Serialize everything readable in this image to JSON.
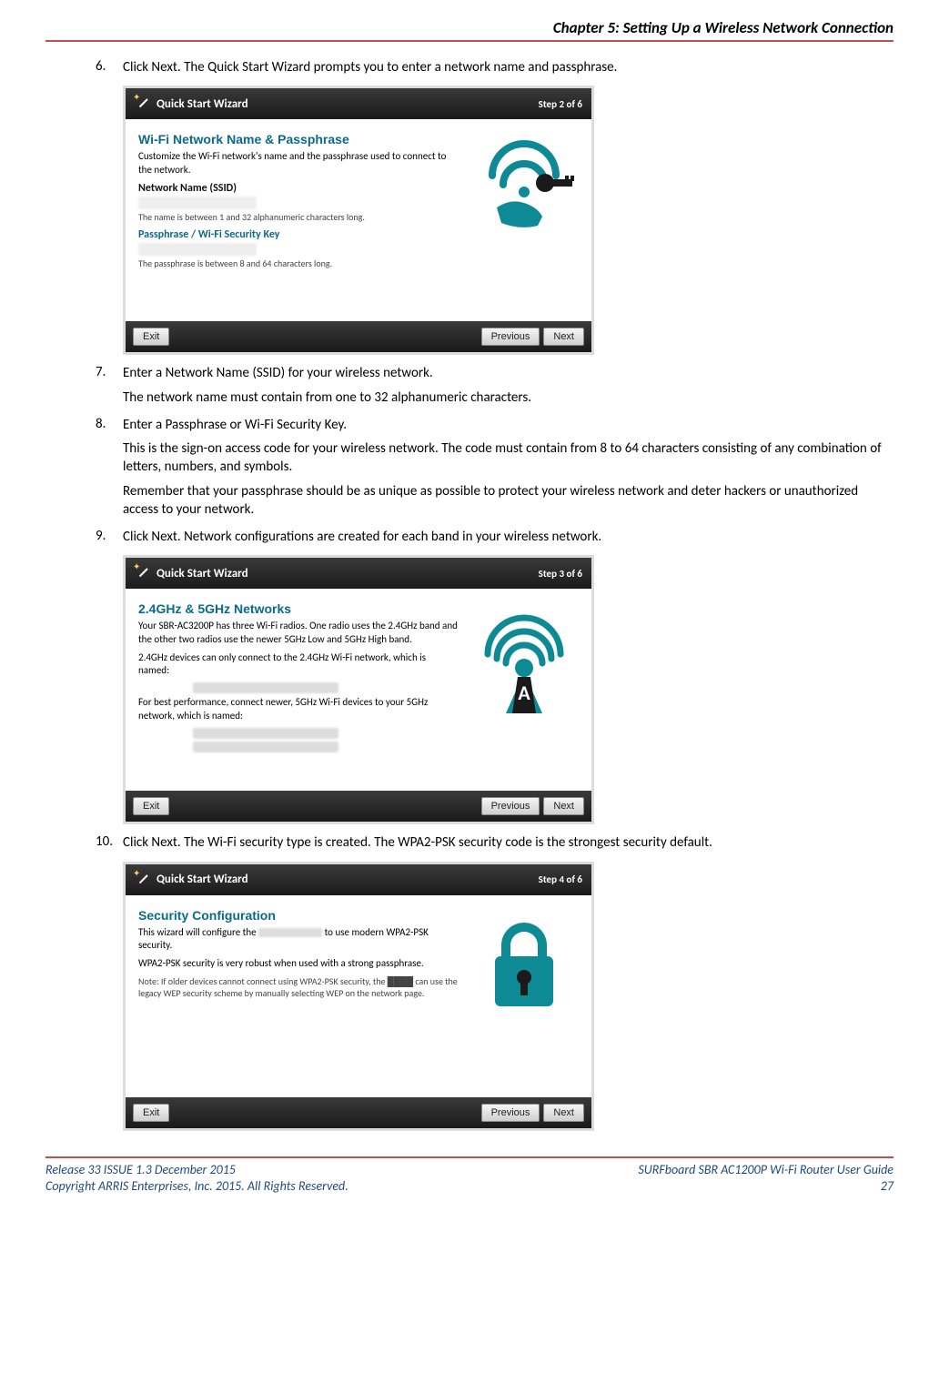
{
  "header": {
    "chapter": "Chapter 5: Setting Up a Wireless Network Connection"
  },
  "steps": {
    "s6": {
      "num": "6.",
      "text": "Click Next. The Quick Start Wizard prompts you to enter a network name and passphrase."
    },
    "s7": {
      "num": "7.",
      "text": "Enter a Network Name (SSID) for your wireless network.",
      "sub": "The network name must contain from one to 32 alphanumeric characters."
    },
    "s8": {
      "num": "8.",
      "text": "Enter a Passphrase or Wi-Fi Security Key.",
      "sub1": "This is the sign-on access code for your wireless network. The code must contain from 8 to 64 characters consisting of any combination of letters, numbers, and symbols.",
      "sub2": "Remember that your passphrase should be as unique as possible to protect your wireless network and deter hackers or unauthorized access to your network."
    },
    "s9": {
      "num": "9.",
      "text": "Click Next.  Network configurations are created for each band in your wireless network."
    },
    "s10": {
      "num": "10.",
      "text": "Click Next. The Wi-Fi security type is created. The WPA2-PSK security code is the strongest security default."
    }
  },
  "wizard_common": {
    "title": "Quick Start Wizard",
    "exit": "Exit",
    "previous": "Previous",
    "next": "Next"
  },
  "wizard2": {
    "step": "Step 2 of 6",
    "heading": "Wi-Fi Network Name & Passphrase",
    "desc": "Customize the Wi-Fi network's name and the passphrase used to connect to the network.",
    "ssid_label": "Network Name (SSID)",
    "ssid_note": "The name is between 1 and 32 alphanumeric characters long.",
    "pass_label": "Passphrase / Wi-Fi Security Key",
    "pass_note": "The passphrase is between 8 and 64 characters long."
  },
  "wizard3": {
    "step": "Step 3 of 6",
    "heading": "2.4GHz & 5GHz Networks",
    "desc": "Your SBR-AC3200P has three Wi-Fi radios. One radio uses the 2.4GHz band and the other two radios use the newer 5GHz Low and 5GHz High band.",
    "line1": "2.4GHz devices can only connect to the 2.4GHz Wi-Fi network, which is named:",
    "line2": "For best performance, connect newer, 5GHz Wi-Fi devices to your 5GHz network, which is named:"
  },
  "wizard4": {
    "step": "Step 4 of 6",
    "heading": "Security Configuration",
    "line1a": "This wizard will configure the",
    "line1b": "to use modern WPA2-PSK security.",
    "line2": "WPA2-PSK security is very robust when used with a strong passphrase.",
    "note": "Note: If older devices cannot connect using WPA2-PSK security, the ████ can use the legacy WEP security scheme by manually selecting WEP on the network page."
  },
  "footer": {
    "release_line": "Release 33 ISSUE 1.3    December 2015",
    "copyright": "Copyright ARRIS Enterprises, Inc. 2015. All Rights Reserved.",
    "product": "SURFboard SBR AC1200P Wi-Fi Router User Guide",
    "page_num": "27"
  }
}
